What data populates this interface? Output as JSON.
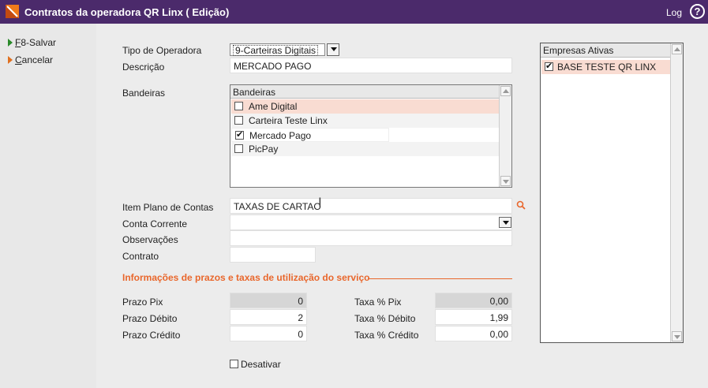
{
  "window": {
    "title": "Contratos da operadora QR Linx ( Edição)",
    "log_label": "Log",
    "help_glyph": "?"
  },
  "sidebar": {
    "save": {
      "underline": "F",
      "rest": "8-Salvar"
    },
    "cancel": {
      "underline": "C",
      "rest": "ancelar"
    }
  },
  "form": {
    "tipo_operadora": {
      "label": "Tipo de Operadora",
      "value": "9-Carteiras Digitais"
    },
    "descricao": {
      "label": "Descrição",
      "value": "MERCADO PAGO"
    },
    "bandeiras": {
      "label": "Bandeiras",
      "header": "Bandeiras",
      "items": [
        {
          "label": "Ame Digital",
          "checked": false
        },
        {
          "label": "Carteira Teste Linx",
          "checked": false
        },
        {
          "label": "Mercado Pago",
          "checked": true
        },
        {
          "label": "PicPay",
          "checked": false
        }
      ]
    },
    "item_plano_contas": {
      "label": "Item Plano de Contas",
      "value": "TAXAS DE CARTAO"
    },
    "conta_corrente": {
      "label": "Conta Corrente",
      "value": ""
    },
    "observacoes": {
      "label": "Observações",
      "value": ""
    },
    "contrato": {
      "label": "Contrato",
      "value": ""
    }
  },
  "section": {
    "title": "Informações de prazos e taxas de utilização do serviço"
  },
  "prazos": {
    "pix": {
      "label": "Prazo Pix",
      "value": "0"
    },
    "debito": {
      "label": "Prazo Débito",
      "value": "2"
    },
    "credito": {
      "label": "Prazo Crédito",
      "value": "0"
    }
  },
  "taxas": {
    "pix": {
      "label": "Taxa % Pix",
      "value": "0,00"
    },
    "debito": {
      "label": "Taxa % Débito",
      "value": "1,99"
    },
    "credito": {
      "label": "Taxa % Crédito",
      "value": "0,00"
    }
  },
  "desativar": {
    "label": "Desativar",
    "checked": false
  },
  "empresas": {
    "header": "Empresas Ativas",
    "items": [
      {
        "label": "BASE TESTE QR LINX",
        "checked": true
      }
    ]
  },
  "colors": {
    "titlebar": "#4b2a6b",
    "accent": "#e9672c",
    "highlight_row": "#f9dcd2"
  }
}
